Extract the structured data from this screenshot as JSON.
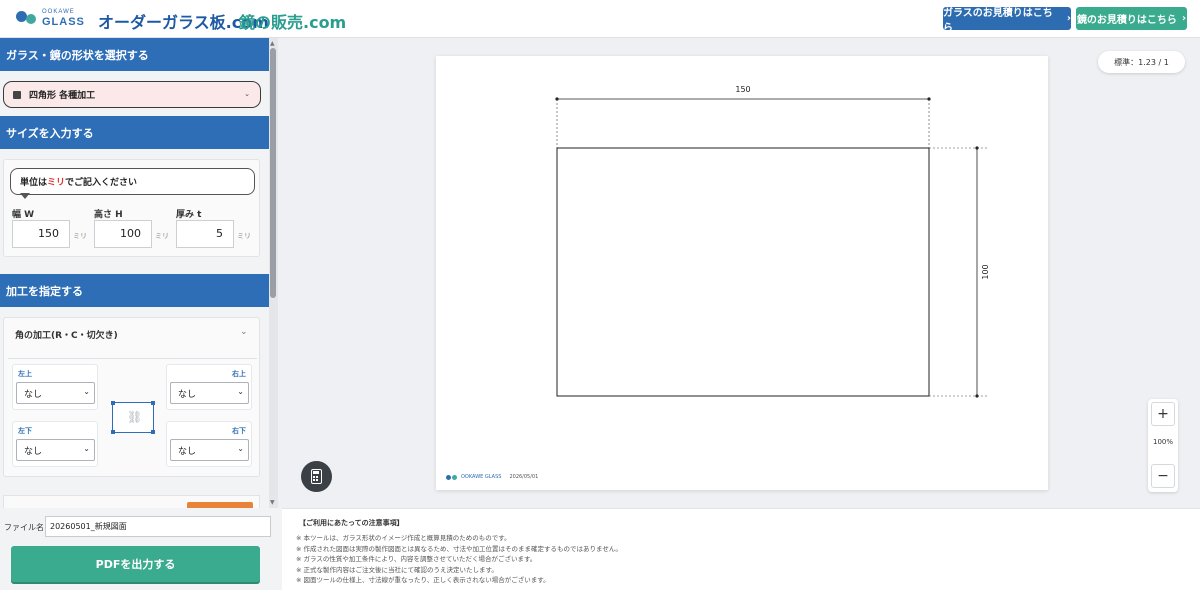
{
  "header": {
    "brand_small": "OOKAWE",
    "brand_name": "GLASS",
    "site1": "オーダーガラス板.com",
    "site2": "鏡の販売.com",
    "btn_glass_quote": "ガラスのお見積りはこちら",
    "btn_mirror_quote": "鏡のお見積りはこちら",
    "colors": {
      "blue": "#2e6cb2",
      "green": "#3bab8f"
    }
  },
  "sidebar": {
    "section1_title": "ガラス・鏡の形状を選択する",
    "shape_select": "四角形 各種加工",
    "section2_title": "サイズを入力する",
    "size_hint_pre": "単位は",
    "size_hint_hl": "ミリ",
    "size_hint_post": "でご記入ください",
    "width_label": "幅 W",
    "height_label": "高さ H",
    "thickness_label": "厚み t",
    "width_value": "150",
    "height_value": "100",
    "thickness_value": "5",
    "unit": "ミリ",
    "section3_title": "加工を指定する",
    "corner_title": "角の加工(R・C・切欠き)",
    "corners": {
      "top_left": {
        "label": "左上",
        "value": "なし"
      },
      "top_right": {
        "label": "右上",
        "value": "なし"
      },
      "bottom_left": {
        "label": "左下",
        "value": "なし"
      },
      "bottom_right": {
        "label": "右下",
        "value": "なし"
      }
    }
  },
  "bottom": {
    "file_label": "ファイル名",
    "file_value": "20260501_新規図面",
    "pdf_button": "PDFを出力する"
  },
  "canvas": {
    "scale": "標準：1.23 / 1",
    "dim_width": "150",
    "dim_height": "100",
    "footer_brand": "OOKAWE GLASS",
    "footer_date": "2026/05/01",
    "zoom_in": "+",
    "zoom_out": "−",
    "zoom_level": "100%"
  },
  "notes": {
    "title": "【ご利用にあたっての注意事項】",
    "items": [
      "※ 本ツールは、ガラス形状のイメージ作成と概算見積のためのものです。",
      "※ 作成された図面は実際の製作図面とは異なるため、寸法や加工位置はそのまま確定するものではありません。",
      "※ ガラスの性質や加工条件により、内容を調整させていただく場合がございます。",
      "※ 正式な製作内容はご注文後に当社にて確認のうえ決定いたします。",
      "※ 図面ツールの仕様上、寸法線が重なったり、正しく表示されない場合がございます。"
    ]
  }
}
